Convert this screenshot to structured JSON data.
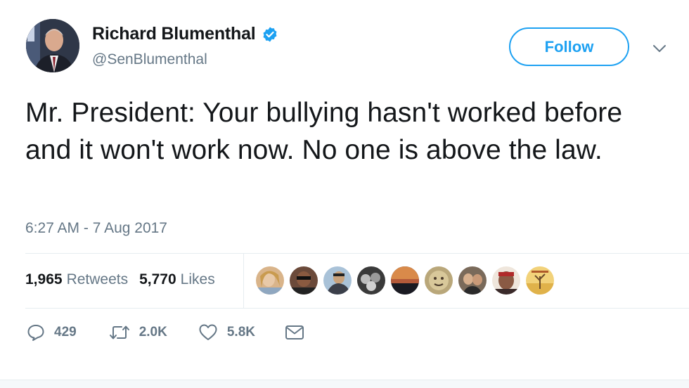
{
  "author": {
    "name": "Richard Blumenthal",
    "handle": "@SenBlumenthal",
    "verified_icon": "verified-badge-icon"
  },
  "follow_button": {
    "label": "Follow"
  },
  "menu_icon": "chevron-down-icon",
  "tweet": {
    "text": "Mr. President: Your bullying hasn't worked before and it won't work now. No one is above the law.",
    "timestamp": "6:27 AM - 7 Aug 2017"
  },
  "stats": {
    "retweets_count": "1,965",
    "retweets_label": "Retweets",
    "likes_count": "5,770",
    "likes_label": "Likes"
  },
  "liker_avatars": [
    "liker-avatar-1",
    "liker-avatar-2",
    "liker-avatar-3",
    "liker-avatar-4",
    "liker-avatar-5",
    "liker-avatar-6",
    "liker-avatar-7",
    "liker-avatar-8",
    "liker-avatar-9"
  ],
  "actions": {
    "reply_count": "429",
    "retweet_count": "2.0K",
    "like_count": "5.8K"
  },
  "colors": {
    "accent": "#1da1f2",
    "text": "#14171a",
    "muted": "#657786",
    "divider": "#e6ecf0"
  }
}
